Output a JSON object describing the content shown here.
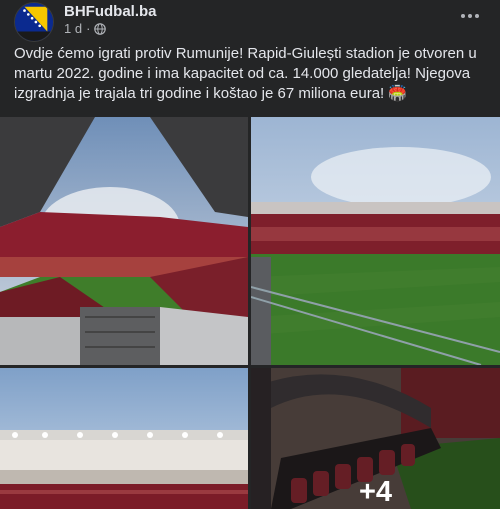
{
  "post": {
    "page_name": "BHFudbal.ba",
    "time": "1 d",
    "separator": "·",
    "text": "Ovdje ćemo igrati protiv Rumunije! Rapid-Giulești stadion je otvoren u martu 2022. godine i ima kapacitet od ca. 14.000 gledatelja! Njegova izgradnja je trajala tri godine i koštao je 67 miliona eura! 🏟️",
    "more_photos_label": "+4",
    "icons": {
      "globe": "globe-icon",
      "more": "more-options-icon"
    }
  },
  "colors": {
    "background": "#242526",
    "text_primary": "#e4e6eb",
    "text_secondary": "#b0b3b8",
    "stadium_maroon": "#8b1e2e",
    "pitch_green": "#3f7d2a"
  }
}
